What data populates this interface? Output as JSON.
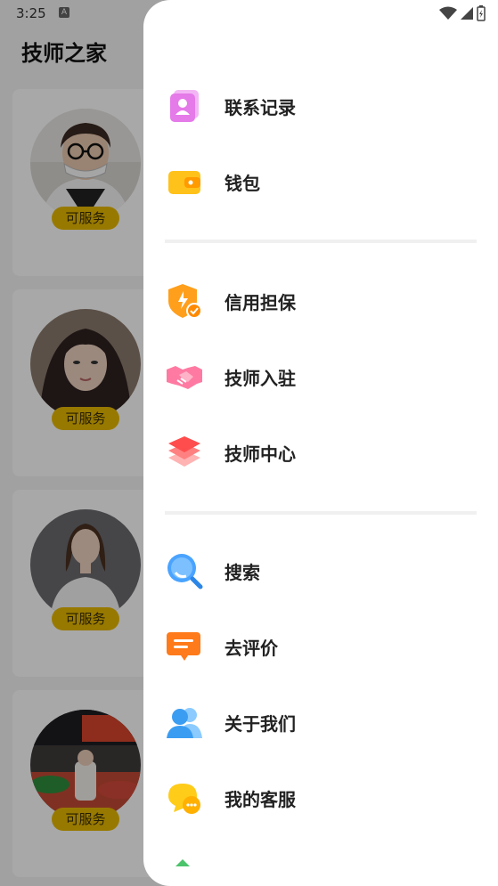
{
  "status_bar": {
    "time": "3:25",
    "notification_letter": "A"
  },
  "app": {
    "title": "技师之家"
  },
  "technicians": [
    {
      "status": "可服务"
    },
    {
      "status": "可服务"
    },
    {
      "status": "可服务"
    },
    {
      "status": "可服务"
    }
  ],
  "drawer": {
    "items": [
      {
        "label": "联系记录",
        "icon": "contacts-record-icon"
      },
      {
        "label": "钱包",
        "icon": "wallet-icon"
      },
      {
        "label": "信用担保",
        "icon": "credit-shield-icon"
      },
      {
        "label": "技师入驻",
        "icon": "handshake-icon"
      },
      {
        "label": "技师中心",
        "icon": "layers-icon"
      },
      {
        "label": "搜索",
        "icon": "search-icon"
      },
      {
        "label": "去评价",
        "icon": "review-chat-icon"
      },
      {
        "label": "关于我们",
        "icon": "about-people-icon"
      },
      {
        "label": "我的客服",
        "icon": "customer-service-icon"
      }
    ]
  },
  "colors": {
    "badge": "#e7b800",
    "overlay": "rgba(0,0,0,0.34)",
    "drawer_bg": "#ffffff"
  }
}
